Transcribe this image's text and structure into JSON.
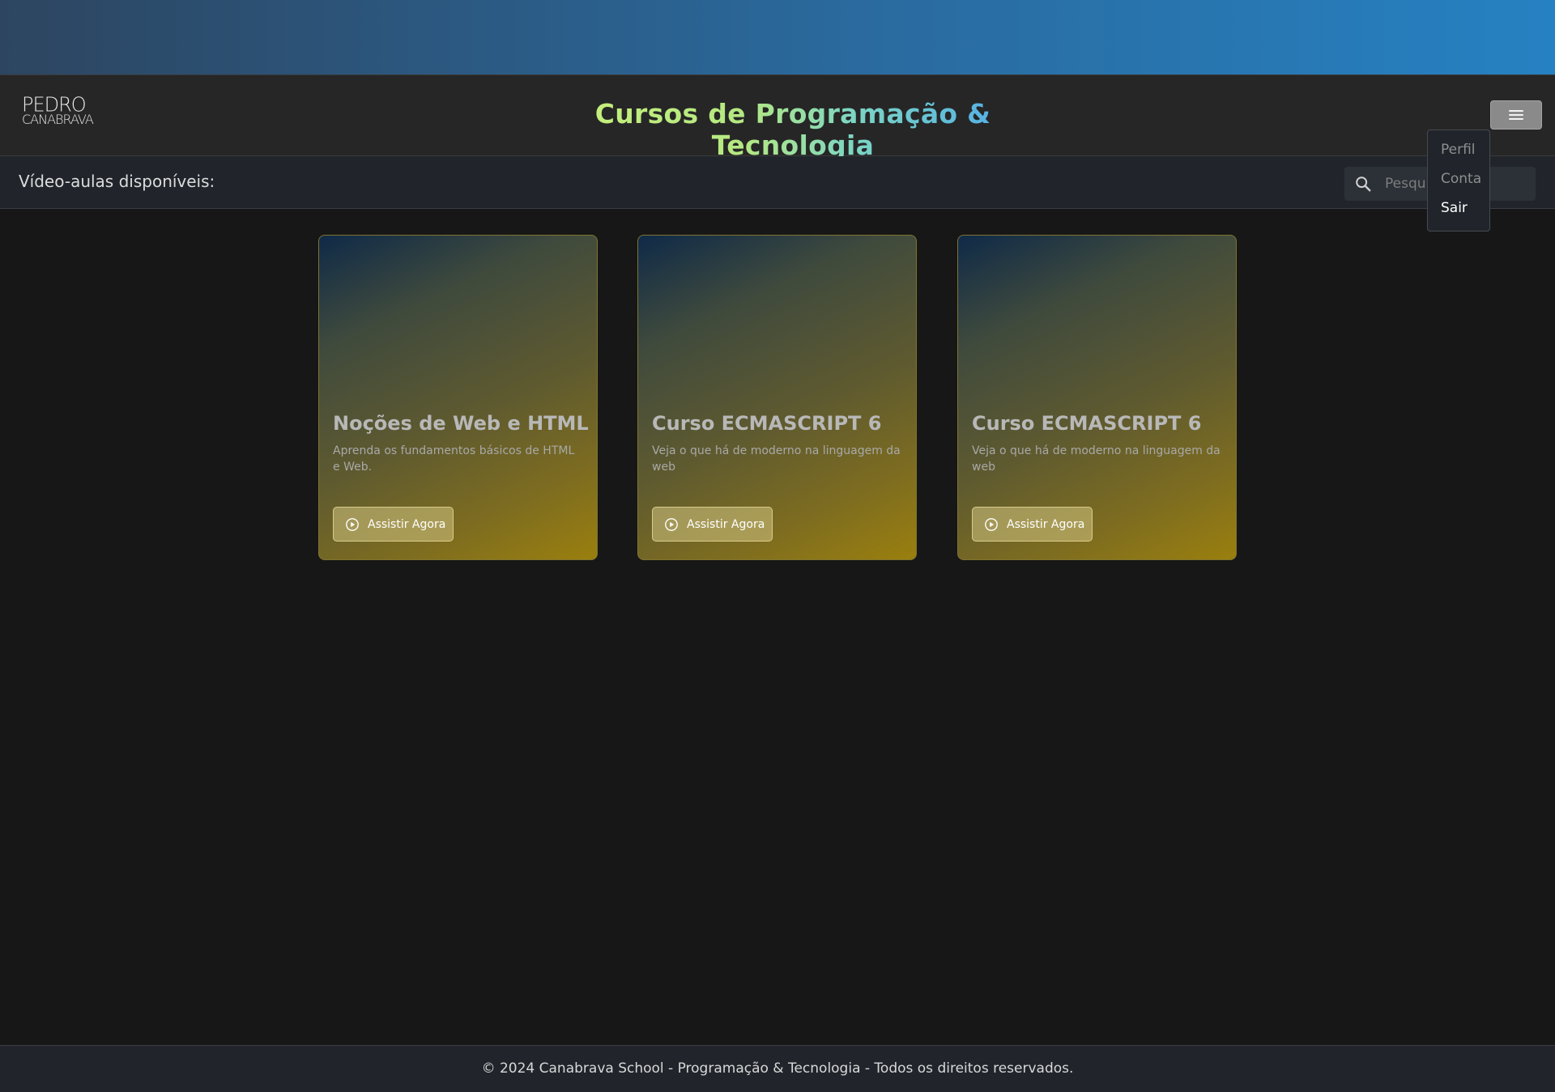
{
  "header": {
    "logo_line1": "PEDRO",
    "logo_line2": "CANABRAVA",
    "title": "Cursos de Programação & Tecnologia"
  },
  "menu": {
    "items": [
      {
        "label": "Perfil",
        "active": false
      },
      {
        "label": "Conta",
        "active": false
      },
      {
        "label": "Sair",
        "active": true
      }
    ]
  },
  "subheader": {
    "label": "Vídeo-aulas disponíveis:"
  },
  "search": {
    "placeholder": "Pesquisar"
  },
  "cards": [
    {
      "title": "Noções de Web e HTML",
      "description": "Aprenda os fundamentos básicos de HTML e Web.",
      "button_label": "Assistir Agora"
    },
    {
      "title": "Curso ECMASCRIPT 6",
      "description": "Veja o que há de moderno na linguagem da web",
      "button_label": "Assistir Agora"
    },
    {
      "title": "Curso ECMASCRIPT 6",
      "description": "Veja o que há de moderno na linguagem da web",
      "button_label": "Assistir Agora"
    }
  ],
  "footer": {
    "text": "© 2024 Canabrava School - Programação & Tecnologia - Todos os direitos reservados."
  },
  "icons": {
    "search": "search-icon",
    "menu": "hamburger-icon",
    "play": "play-circle-icon"
  },
  "colors": {
    "topbar_start": "#2d4560",
    "topbar_end": "#2681c2",
    "title_start": "#c8f07a",
    "title_end": "#4aa8ee",
    "card_gradient_start": "#0f2a48",
    "card_gradient_end": "#9a7f0e"
  }
}
